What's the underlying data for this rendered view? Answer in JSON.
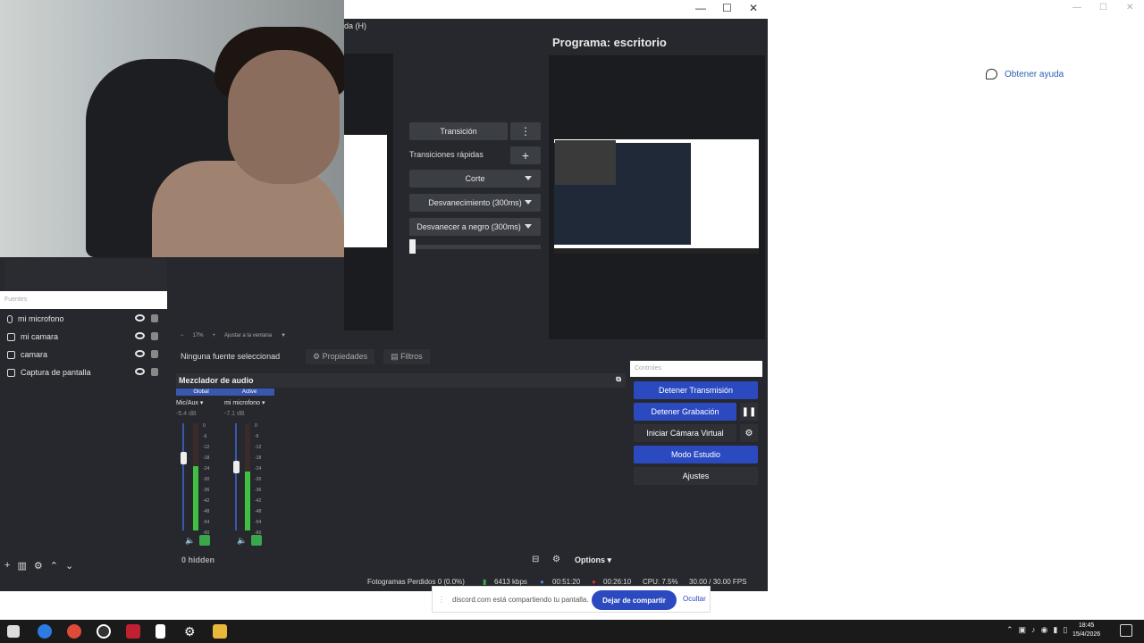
{
  "help": {
    "label": "Obtener ayuda"
  },
  "obs": {
    "menu_fragment": "da (H)",
    "program_title": "Programa: escritorio",
    "transition_button": "Transición",
    "quick_transitions_label": "Transiciones rápidas",
    "transitions": [
      "Corte",
      "Desvanecimiento (300ms)",
      "Desvanecer a negro (300ms)"
    ],
    "zoom": {
      "minus": "−",
      "percent": "17%",
      "plus": "+",
      "fit": "Ajustar a la ventana"
    },
    "sources_header": "Fuentes",
    "sources": [
      {
        "label": "mi microfono",
        "icon": "microphone-icon"
      },
      {
        "label": "mi camara",
        "icon": "camera-icon"
      },
      {
        "label": "camara",
        "icon": "camera-icon"
      },
      {
        "label": "Captura de pantalla",
        "icon": "monitor-icon"
      }
    ],
    "properties_bar": {
      "no_source": "Ninguna fuente seleccionad",
      "properties": "Propiedades",
      "filters": "Filtros"
    },
    "mixer": {
      "title": "Mezclador de audio",
      "channels": [
        {
          "tag": "Global",
          "name": "Mic/Aux",
          "db": "-5.4 dB",
          "level": 0.6,
          "volume": 0.7
        },
        {
          "tag": "Active",
          "name": "mi microfono",
          "db": "-7.1 dB",
          "level": 0.55,
          "volume": 0.6
        }
      ],
      "scale": [
        "0",
        "-6",
        "-12",
        "-18",
        "-24",
        "-30",
        "-36",
        "-42",
        "-48",
        "-54",
        "-60"
      ],
      "hidden_label": "0 hidden",
      "options_label": "Options"
    },
    "controls": {
      "header": "Controles",
      "stop_stream": "Detener Transmisión",
      "stop_record": "Detener Grabación",
      "virtual_cam": "Iniciar Cámara Virtual",
      "studio_mode": "Modo Estudio",
      "settings": "Ajustes"
    },
    "status": {
      "dropped": "Fotogramas Perdidos 0 (0.0%)",
      "bitrate": "6413 kbps",
      "stream_time": "00:51:20",
      "record_time": "00:26:10",
      "cpu": "CPU: 7.5%",
      "fps": "30.00 / 30.00 FPS"
    }
  },
  "discord": {
    "message": "discord.com está compartiendo tu pantalla.",
    "stop_share": "Dejar de compartir",
    "hide": "Ocultar"
  },
  "taskbar": {
    "time": "18:45",
    "date": "15/4/2026"
  },
  "colors": {
    "obs_bg": "#26282d",
    "accent_blue": "#2c4ac0",
    "meter_green": "#40c040"
  }
}
